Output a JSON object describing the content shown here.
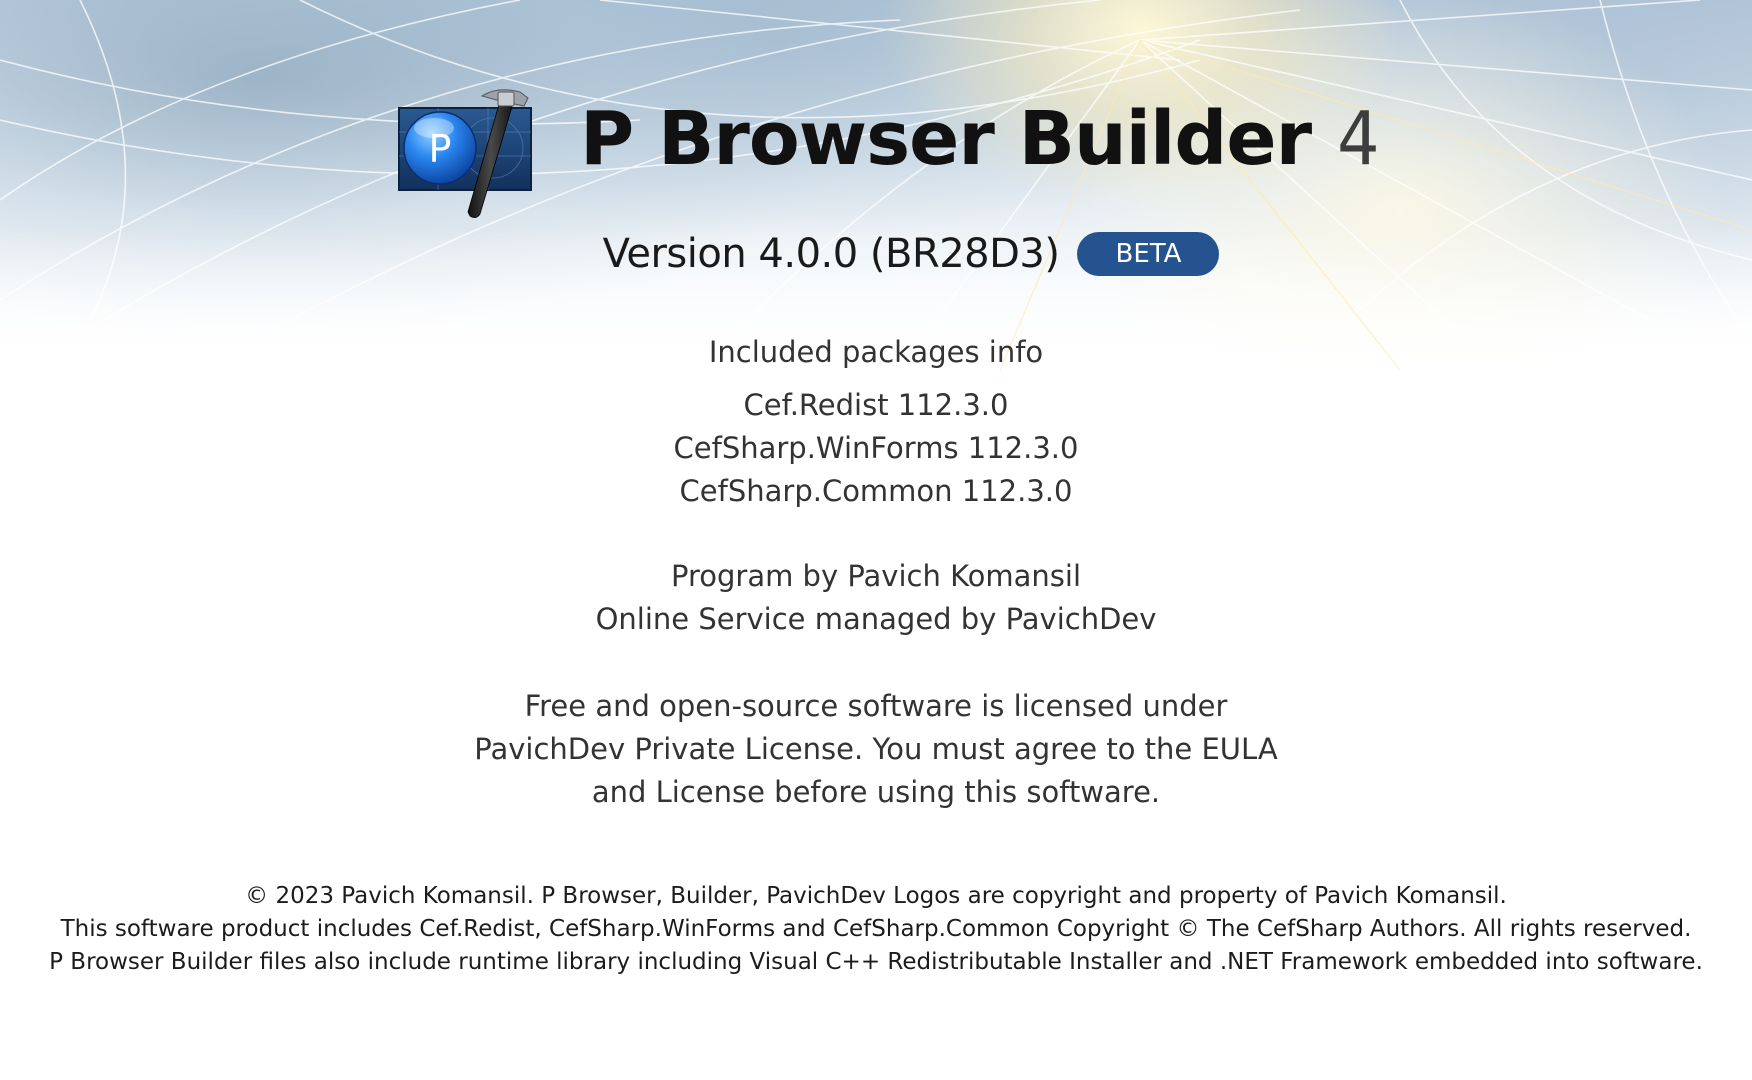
{
  "window": {
    "title": "P Browser Builder 4"
  },
  "header": {
    "app_name": "P Browser Builder",
    "major_version": "4",
    "version_text": "Version 4.0.0 (BR28D3)",
    "badge": "BETA",
    "logo_letter": "P"
  },
  "colors": {
    "badge_bg": "#25538f",
    "logo_circle": "#1a6fe0",
    "logo_square": "#1b3a66"
  },
  "icons": {
    "app_logo": "app-logo-icon",
    "hammer": "hammer-icon"
  },
  "packages": {
    "title": "Included packages info",
    "items": [
      "Cef.Redist 112.3.0",
      "CefSharp.WinForms 112.3.0",
      "CefSharp.Common 112.3.0"
    ]
  },
  "credits": {
    "program_by": "Program by Pavich Komansil",
    "service_by": "Online Service managed by PavichDev"
  },
  "license": {
    "lines": [
      "Free and open-source software is licensed under",
      "PavichDev Private License. You must agree to the EULA",
      "and License before using this software."
    ]
  },
  "legal": {
    "lines": [
      "© 2023 Pavich Komansil. P Browser, Builder, PavichDev Logos are copyright and property of Pavich Komansil.",
      "This software product includes Cef.Redist, CefSharp.WinForms and CefSharp.Common Copyright © The CefSharp Authors. All rights reserved.",
      "P Browser Builder files also include runtime library including Visual C++ Redistributable Installer and .NET Framework embedded into software."
    ]
  }
}
